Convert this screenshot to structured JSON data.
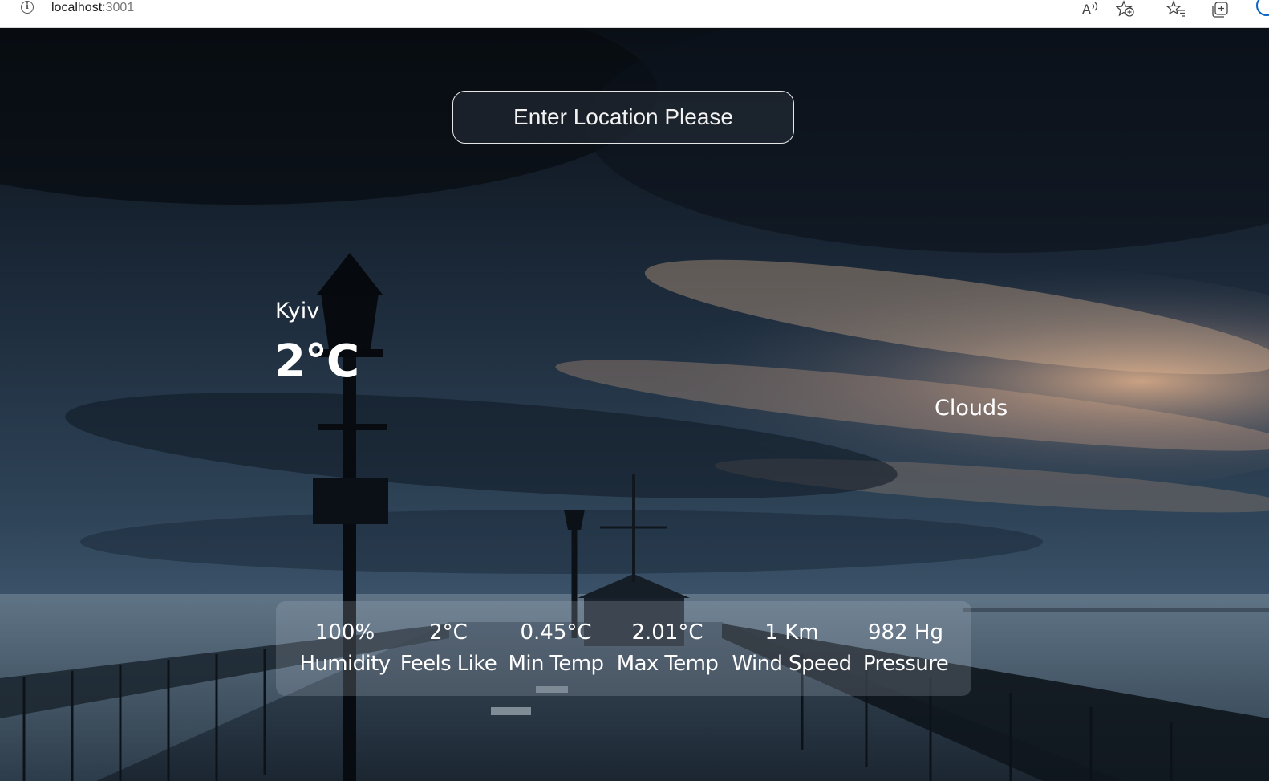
{
  "browser": {
    "url_host": "localhost",
    "url_port": ":3001"
  },
  "search": {
    "placeholder": "Enter Location Please",
    "value": ""
  },
  "weather": {
    "city": "Kyiv",
    "temperature": "2°C",
    "description": "Clouds"
  },
  "stats": [
    {
      "value": "100%",
      "label": "Humidity"
    },
    {
      "value": "2°C",
      "label": "Feels Like"
    },
    {
      "value": "0.45°C",
      "label": "Min Temp"
    },
    {
      "value": "2.01°C",
      "label": "Max Temp"
    },
    {
      "value": "1 Km",
      "label": "Wind Speed"
    },
    {
      "value": "982 Hg",
      "label": "Pressure"
    }
  ],
  "colors": {
    "text": "#ffffff",
    "panel": "rgba(180,190,205,0.22)",
    "sky_glow": "#e8b58e"
  },
  "icons": [
    "info-icon",
    "read-aloud-icon",
    "add-favorite-icon",
    "favorites-icon",
    "collections-icon"
  ]
}
